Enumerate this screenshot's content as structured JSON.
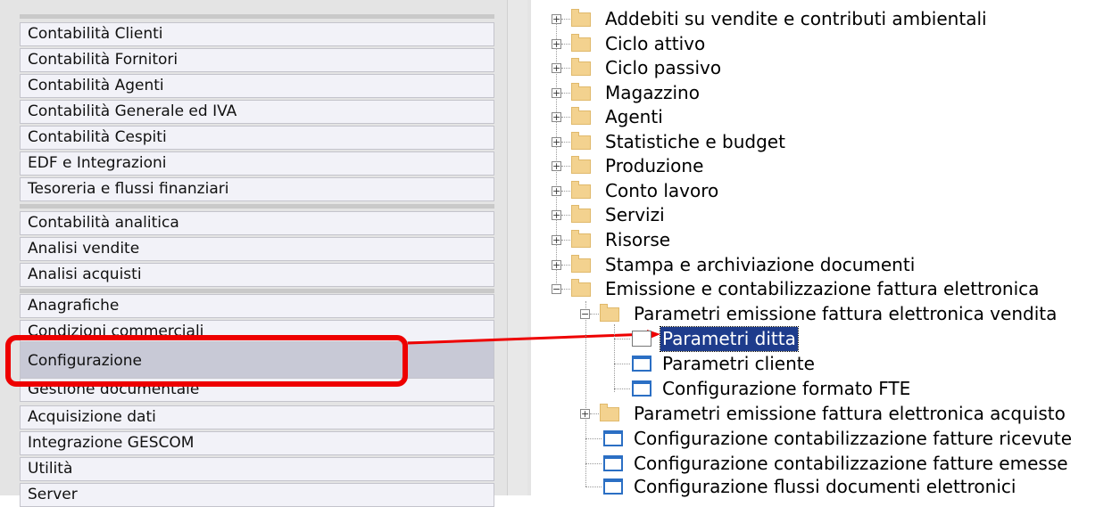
{
  "left_menu": {
    "group1": [
      "Contabilità Clienti",
      "Contabilità Fornitori",
      "Contabilità Agenti",
      "Contabilità Generale ed IVA",
      "Contabilità Cespiti",
      "EDF e Integrazioni",
      "Tesoreria e flussi finanziari"
    ],
    "group2": [
      "Contabilità analitica",
      "Analisi vendite",
      "Analisi acquisti"
    ],
    "group3": [
      "Anagrafiche",
      "Condizioni commerciali",
      "Configurazione",
      "Gestione documentale",
      "Acquisizione dati",
      "Integrazione GESCOM",
      "Utilità",
      "Server"
    ],
    "selected": "Configurazione"
  },
  "tree": {
    "top_folders": [
      "Addebiti su vendite e contributi ambientali",
      "Ciclo attivo",
      "Ciclo passivo",
      "Magazzino",
      "Agenti",
      "Statistiche e budget",
      "Produzione",
      "Conto lavoro",
      "Servizi",
      "Risorse",
      "Stampa e archiviazione documenti",
      "Emissione e contabilizzazione fattura elettronica"
    ],
    "sub_folder_1": "Parametri emissione fattura elettronica vendita",
    "sub_items_1": [
      "Parametri ditta",
      "Parametri cliente",
      "Configurazione formato FTE"
    ],
    "sub_folder_2": "Parametri emissione fattura elettronica acquisto",
    "leaf_items": [
      "Configurazione contabilizzazione fatture ricevute",
      "Configurazione contabilizzazione fatture emesse",
      "Configurazione flussi documenti elettronici"
    ],
    "selected_item": "Parametri ditta"
  },
  "annotation_color": "#ee0000"
}
